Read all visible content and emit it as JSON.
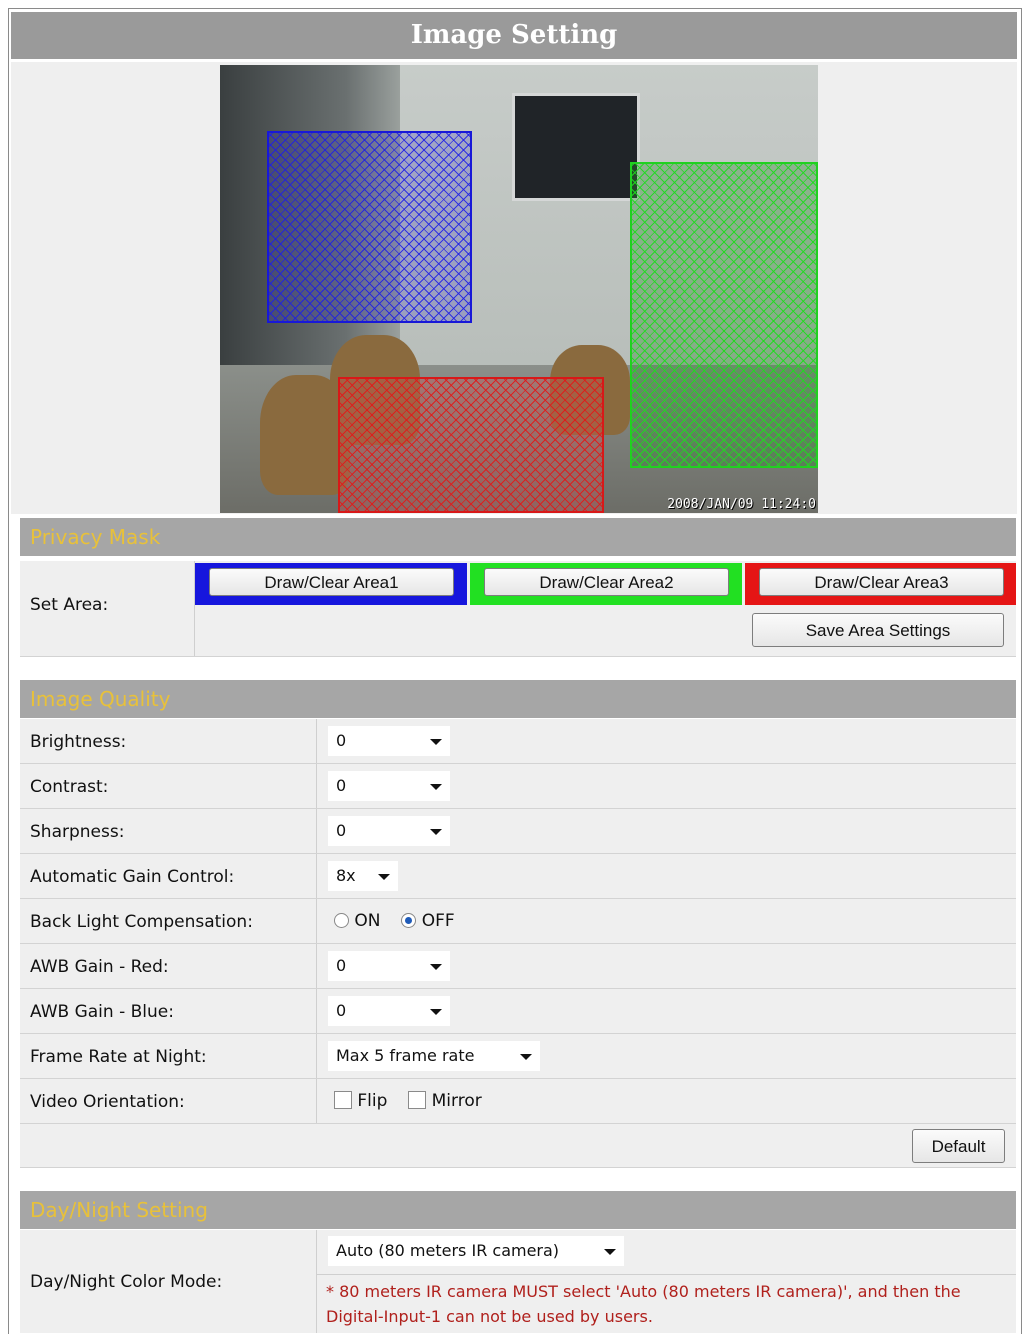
{
  "title": "Image Setting",
  "camera": {
    "timestamp": "2008/JAN/09 11:24:0"
  },
  "privacy_mask": {
    "section_label": "Privacy Mask",
    "set_area_label": "Set Area:",
    "area1_button": "Draw/Clear Area1",
    "area2_button": "Draw/Clear Area2",
    "area3_button": "Draw/Clear Area3",
    "save_button": "Save Area Settings",
    "area_colors": {
      "area1": "#1818d8",
      "area2": "#20d020",
      "area3": "#d81818"
    }
  },
  "image_quality": {
    "section_label": "Image Quality",
    "brightness": {
      "label": "Brightness:",
      "value": "0"
    },
    "contrast": {
      "label": "Contrast:",
      "value": "0"
    },
    "sharpness": {
      "label": "Sharpness:",
      "value": "0"
    },
    "agc": {
      "label": "Automatic Gain Control:",
      "value": "8x"
    },
    "blc": {
      "label": "Back Light Compensation:",
      "on_label": "ON",
      "off_label": "OFF",
      "selected": "OFF"
    },
    "awb_red": {
      "label": "AWB Gain - Red:",
      "value": "0"
    },
    "awb_blue": {
      "label": "AWB Gain - Blue:",
      "value": "0"
    },
    "frame_rate": {
      "label": "Frame Rate at Night:",
      "value": "Max 5 frame rate"
    },
    "orientation": {
      "label": "Video Orientation:",
      "flip_label": "Flip",
      "mirror_label": "Mirror",
      "flip_checked": false,
      "mirror_checked": false
    },
    "default_button": "Default"
  },
  "day_night": {
    "section_label": "Day/Night Setting",
    "color_mode": {
      "label": "Day/Night Color Mode:",
      "value": "Auto (80 meters IR camera)"
    },
    "note": "* 80 meters IR camera MUST select 'Auto (80 meters IR camera)', and then the Digital-Input-1 can not be used by users."
  },
  "colors": {
    "section_bg": "#a6a6a6",
    "section_text": "#e8c13a",
    "note_text": "#b0201c"
  }
}
